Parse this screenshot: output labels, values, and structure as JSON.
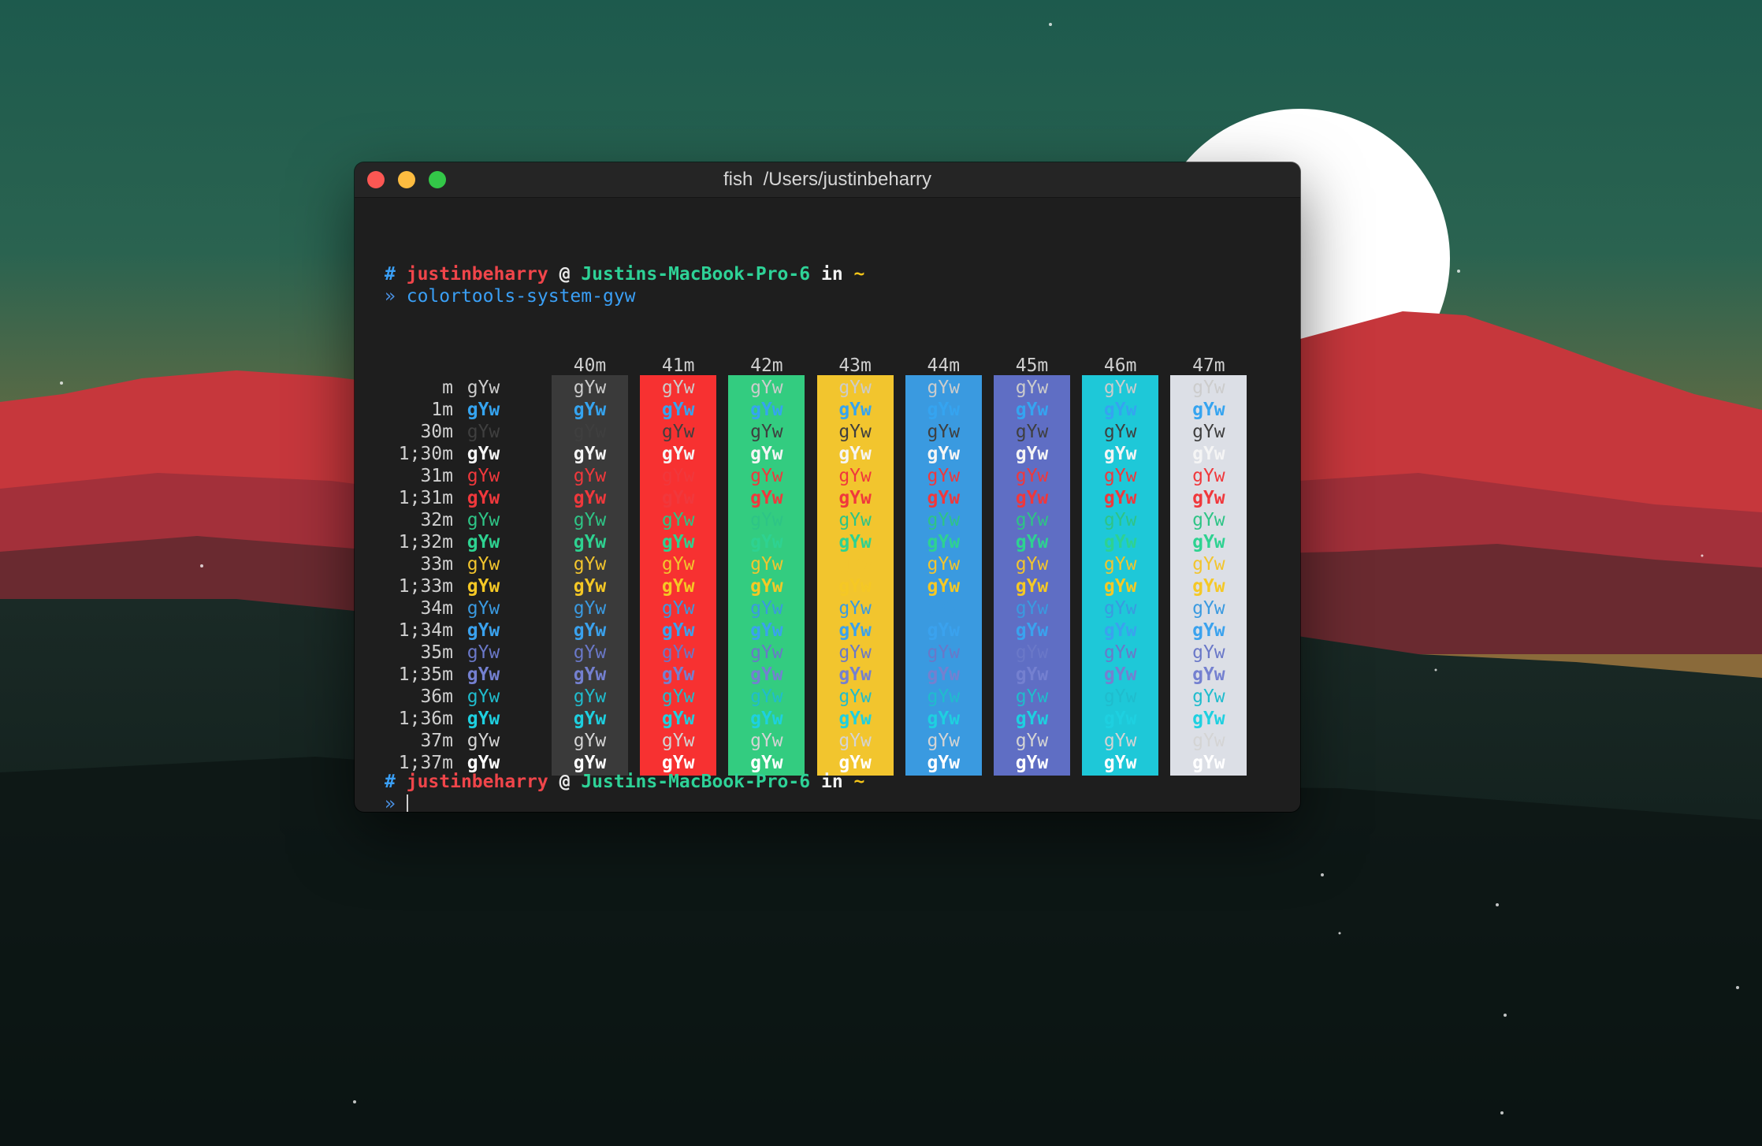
{
  "window": {
    "title": "fish  /Users/justinbeharry"
  },
  "prompt1": {
    "hash": "#",
    "user": "justinbeharry",
    "at": "@",
    "host": "Justins-MacBook-Pro-6",
    "in": "in",
    "dir": "~",
    "arrow": "»",
    "command": "colortools-system-gyw"
  },
  "prompt2": {
    "hash": "#",
    "user": "justinbeharry",
    "at": "@",
    "host": "Justins-MacBook-Pro-6",
    "in": "in",
    "dir": "~",
    "arrow": "»"
  },
  "sample_text": "gYw",
  "colors": {
    "prompt_hash": "#3a9ff5",
    "prompt_user": "#f0454a",
    "prompt_at": "#e8e8e8",
    "prompt_host": "#2ed297",
    "prompt_in": "#f2f2f2",
    "prompt_dir": "#f5c518",
    "prompt_arrow": "#4a90e2",
    "command": "#3a9ff5"
  },
  "table": {
    "columns": [
      "40m",
      "41m",
      "42m",
      "43m",
      "44m",
      "45m",
      "46m",
      "47m"
    ],
    "column_bg": [
      "#3a3a3a",
      "#f73131",
      "#33cc80",
      "#f2c52e",
      "#3a9ae0",
      "#5f6ec4",
      "#1ec8d8",
      "#dcdfe6"
    ],
    "rows": [
      {
        "label": "m",
        "fg": "#cccccc",
        "bold": false
      },
      {
        "label": "1m",
        "fg": "#35a4f0",
        "bold": true
      },
      {
        "label": "30m",
        "fg": "#3f3f3f",
        "bold": false
      },
      {
        "label": "1;30m",
        "fg": "#f5f5f5",
        "bold": true
      },
      {
        "label": "31m",
        "fg": "#f0383c",
        "bold": false
      },
      {
        "label": "1;31m",
        "fg": "#f0383c",
        "bold": true
      },
      {
        "label": "32m",
        "fg": "#2ec486",
        "bold": false
      },
      {
        "label": "1;32m",
        "fg": "#2ed291",
        "bold": true
      },
      {
        "label": "33m",
        "fg": "#f2c52e",
        "bold": false
      },
      {
        "label": "1;33m",
        "fg": "#f5c825",
        "bold": true
      },
      {
        "label": "34m",
        "fg": "#3a9ae0",
        "bold": false
      },
      {
        "label": "1;34m",
        "fg": "#3aa2ee",
        "bold": true
      },
      {
        "label": "35m",
        "fg": "#6a78c8",
        "bold": false
      },
      {
        "label": "1;35m",
        "fg": "#7480d0",
        "bold": true
      },
      {
        "label": "36m",
        "fg": "#20bccd",
        "bold": false
      },
      {
        "label": "1;36m",
        "fg": "#1ed0e0",
        "bold": true
      },
      {
        "label": "37m",
        "fg": "#d4d4d4",
        "bold": false
      },
      {
        "label": "1;37m",
        "fg": "#ffffff",
        "bold": true
      }
    ]
  }
}
